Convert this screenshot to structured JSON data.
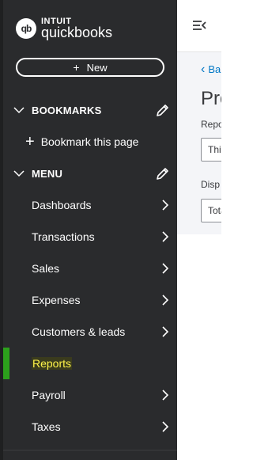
{
  "brand": {
    "intuit": "INTUIT",
    "name": "quickbooks",
    "mark": "qb"
  },
  "new_button": {
    "plus": "+",
    "label": "New"
  },
  "bookmarks": {
    "title": "BOOKMARKS",
    "add_plus": "+",
    "add_label": "Bookmark this page"
  },
  "menu": {
    "title": "MENU",
    "items": [
      {
        "label": "Dashboards"
      },
      {
        "label": "Transactions"
      },
      {
        "label": "Sales"
      },
      {
        "label": "Expenses"
      },
      {
        "label": "Customers & leads"
      },
      {
        "label": "Reports",
        "active": true
      },
      {
        "label": "Payroll"
      },
      {
        "label": "Taxes"
      }
    ]
  },
  "content": {
    "back_link": "Ba",
    "page_title": "Pro",
    "field1_label": "Repo",
    "field1_value": "This",
    "field2_label": "Disp",
    "field2_value": "Tota"
  },
  "colors": {
    "sidebar": "#2a2b2d",
    "accent": "#2ca01c",
    "active_text": "#fff44a",
    "link": "#0077c5"
  }
}
